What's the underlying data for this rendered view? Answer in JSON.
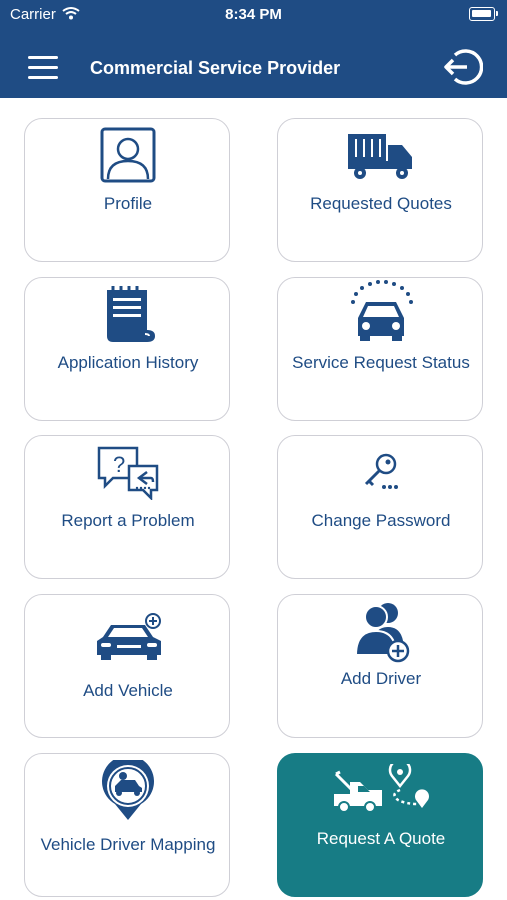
{
  "status_bar": {
    "carrier": "Carrier",
    "time": "8:34 PM"
  },
  "header": {
    "title": "Commercial Service Provider"
  },
  "colors": {
    "brand": "#1f4c84",
    "accent_tile": "#177c85",
    "tile_border": "#cfcfd6"
  },
  "tiles": [
    {
      "label": "Profile",
      "icon": "profile-icon"
    },
    {
      "label": "Requested Quotes",
      "icon": "truck-icon"
    },
    {
      "label": "Application History",
      "icon": "history-scroll-icon"
    },
    {
      "label": "Service Request Status",
      "icon": "car-status-icon"
    },
    {
      "label": "Report a Problem",
      "icon": "chat-question-icon"
    },
    {
      "label": "Change Password",
      "icon": "key-password-icon"
    },
    {
      "label": "Add Vehicle",
      "icon": "add-car-icon"
    },
    {
      "label": "Add Driver",
      "icon": "add-user-icon"
    },
    {
      "label": "Vehicle Driver Mapping",
      "icon": "map-pin-car-icon"
    },
    {
      "label": "Request A Quote",
      "icon": "tow-truck-route-icon"
    }
  ]
}
